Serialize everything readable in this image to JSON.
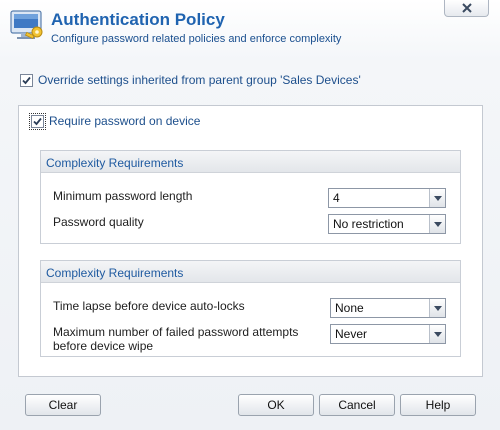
{
  "dialog": {
    "title": "Authentication Policy",
    "subtitle": "Configure password related policies and enforce complexity",
    "close_icon": "close-icon",
    "app_icon": "policy-key-icon"
  },
  "override": {
    "label": "Override settings inherited from parent group 'Sales Devices'",
    "checked": true
  },
  "require_password": {
    "label": "Require password on device",
    "checked": true
  },
  "groups": [
    {
      "title": "Complexity Requirements",
      "fields": [
        {
          "label": "Minimum password length",
          "value": "4"
        },
        {
          "label": "Password quality",
          "value": "No restriction"
        }
      ]
    },
    {
      "title": "Complexity Requirements",
      "fields": [
        {
          "label": "Time lapse before device auto-locks",
          "value": "None"
        },
        {
          "label_line1": "Maximum number of failed password attempts",
          "label_line2": "before device wipe",
          "value": "Never"
        }
      ]
    }
  ],
  "buttons": {
    "clear": "Clear",
    "ok": "OK",
    "cancel": "Cancel",
    "help": "Help"
  },
  "colors": {
    "title": "#1f63b0",
    "label_blue": "#1d4f8c"
  }
}
